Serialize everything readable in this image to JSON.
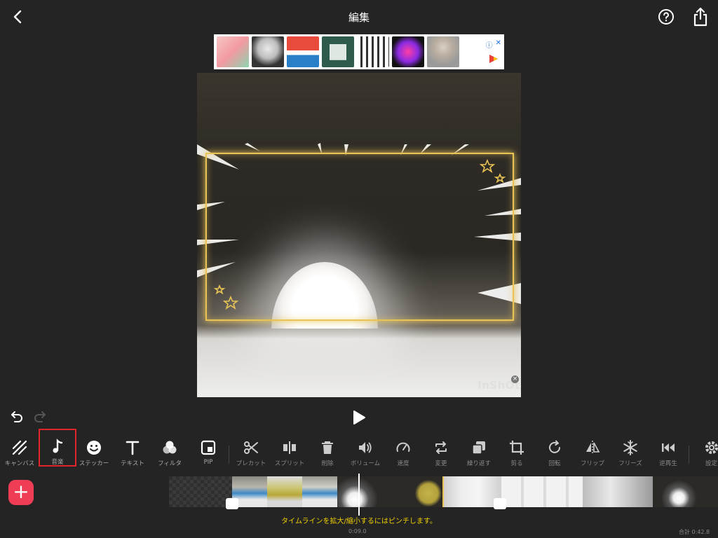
{
  "header": {
    "title": "編集"
  },
  "ad": {
    "info_label": "ⓘ",
    "close_label": "✕"
  },
  "preview": {
    "watermark": "InShOt"
  },
  "toolbar": {
    "tools": [
      {
        "id": "canvas",
        "label": "キャンバス"
      },
      {
        "id": "music",
        "label": "音楽"
      },
      {
        "id": "sticker",
        "label": "ステッカー"
      },
      {
        "id": "text",
        "label": "テキスト"
      },
      {
        "id": "filter",
        "label": "フィルタ"
      },
      {
        "id": "pip",
        "label": "PIP"
      },
      {
        "id": "precut",
        "label": "プレカット"
      },
      {
        "id": "split",
        "label": "スプリット"
      },
      {
        "id": "delete",
        "label": "削除"
      },
      {
        "id": "volume",
        "label": "ボリューム"
      },
      {
        "id": "speed",
        "label": "速度"
      },
      {
        "id": "replace",
        "label": "変更"
      },
      {
        "id": "repeat",
        "label": "繰り返す"
      },
      {
        "id": "crop",
        "label": "剪る"
      },
      {
        "id": "rotate",
        "label": "回転"
      },
      {
        "id": "flip",
        "label": "フリップ"
      },
      {
        "id": "freeze",
        "label": "フリーズ"
      },
      {
        "id": "reverse",
        "label": "逆再生"
      },
      {
        "id": "settings",
        "label": "設定"
      }
    ],
    "selected": "音楽"
  },
  "timeline": {
    "add_label": "+",
    "hint": "タイムラインを拡大/縮小するにはピンチします。",
    "timecode": "0:09.0",
    "total": "合計 0:42.8"
  },
  "colors": {
    "accent": "#ef3d55",
    "frame": "#e9c455",
    "hint": "#f0d000",
    "selection": "#e0262a"
  }
}
